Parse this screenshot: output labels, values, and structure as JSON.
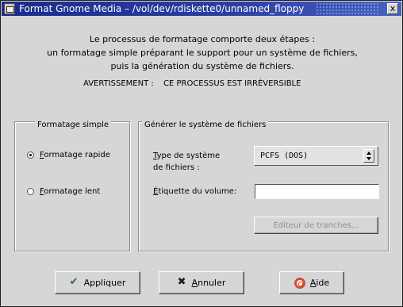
{
  "window": {
    "title": "Format Gnome Media – /vol/dev/rdiskette0/unnamed_floppy",
    "close_label": "x"
  },
  "intro": {
    "line1": "Le processus de formatage comporte deux étapes :",
    "line2": "un formatage simple préparant le support pour un système de fichiers,",
    "line3": "puis la génération du système de fichiers."
  },
  "warning": {
    "label": "AVERTISSEMENT :",
    "text": "CE PROCESSUS EST IRRÉVERSIBLE"
  },
  "simple_format": {
    "title": "Formatage simple",
    "options": [
      {
        "mnemonic": "F",
        "rest": "ormatage rapide",
        "checked": true
      },
      {
        "mnemonic": "F",
        "rest": "ormatage lent",
        "checked": false
      }
    ]
  },
  "filesystem": {
    "title": "Générer le système de fichiers",
    "type_label_mnemonic": "T",
    "type_label_line1_rest": "ype de système",
    "type_label_line2": "de fichiers :",
    "type_value": "PCFS (DOS)",
    "volume_label_mnemonic": "É",
    "volume_label_rest": "tiquette du volume:",
    "volume_value": "",
    "slice_editor_label": "Éditeur de tranches..."
  },
  "buttons": {
    "apply": "Appliquer",
    "cancel_mnemonic": "A",
    "cancel_rest": "nnuler",
    "help_mnemonic": "A",
    "help_rest": "ide"
  },
  "icons": {
    "window": "window-icon",
    "apply": "check-icon",
    "cancel": "x-icon",
    "help": "lifebuoy-icon"
  }
}
